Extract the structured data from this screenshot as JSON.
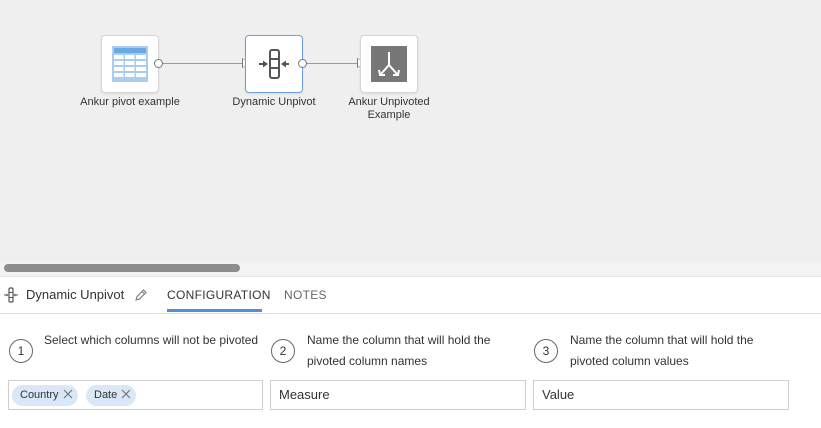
{
  "workflow": {
    "nodes": [
      {
        "label": "Ankur pivot example",
        "icon": "table-icon"
      },
      {
        "label": "Dynamic Unpivot",
        "icon": "unpivot-icon"
      },
      {
        "label": "Ankur Unpivoted Example",
        "icon": "output-merge-icon"
      }
    ]
  },
  "panel": {
    "title": "Dynamic Unpivot",
    "tabs": [
      {
        "label": "CONFIGURATION",
        "active": true
      },
      {
        "label": "NOTES",
        "active": false
      }
    ]
  },
  "steps": [
    {
      "number": "1",
      "text": "Select which columns will not be pivoted"
    },
    {
      "number": "2",
      "text": "Name the column that will hold the pivoted column names"
    },
    {
      "number": "3",
      "text": "Name the column that will hold the pivoted column values"
    }
  ],
  "fields": {
    "fixed_columns": [
      "Country",
      "Date"
    ],
    "names_column": "Measure",
    "values_column": "Value"
  },
  "colors": {
    "accent": "#4f8fe0",
    "chip": "#d9e7f7",
    "canvas": "#efefef"
  }
}
